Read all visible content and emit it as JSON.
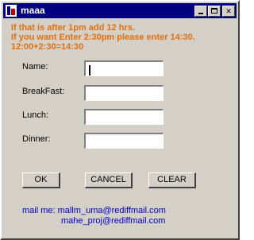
{
  "window": {
    "title": "maaa",
    "controls": {
      "minimize": "_",
      "maximize": "□",
      "close": "✕"
    }
  },
  "info": {
    "line1": "If that is after 1pm add 12 hrs.",
    "line2": "If you want Enter 2:30pm please enter 14:30.",
    "line3": "12:00+2:30=14:30"
  },
  "form": {
    "name_label": "Name:",
    "breakfast_label": "BreakFast:",
    "lunch_label": "Lunch:",
    "dinner_label": "Dinner:",
    "name_value": "",
    "breakfast_value": "",
    "lunch_value": "",
    "dinner_value": ""
  },
  "buttons": {
    "ok": "OK",
    "cancel": "CANCEL",
    "clear": "CLEAR"
  },
  "contact": {
    "prefix": "mail me:",
    "email1": "mallm_uma@rediffmail.com",
    "email2": "mahe_proj@rediffmail.com"
  },
  "colors": {
    "titlebar": "#000080",
    "info_text": "#e07010",
    "mail_text": "#0000cc",
    "window_bg": "#d4d0c8"
  }
}
